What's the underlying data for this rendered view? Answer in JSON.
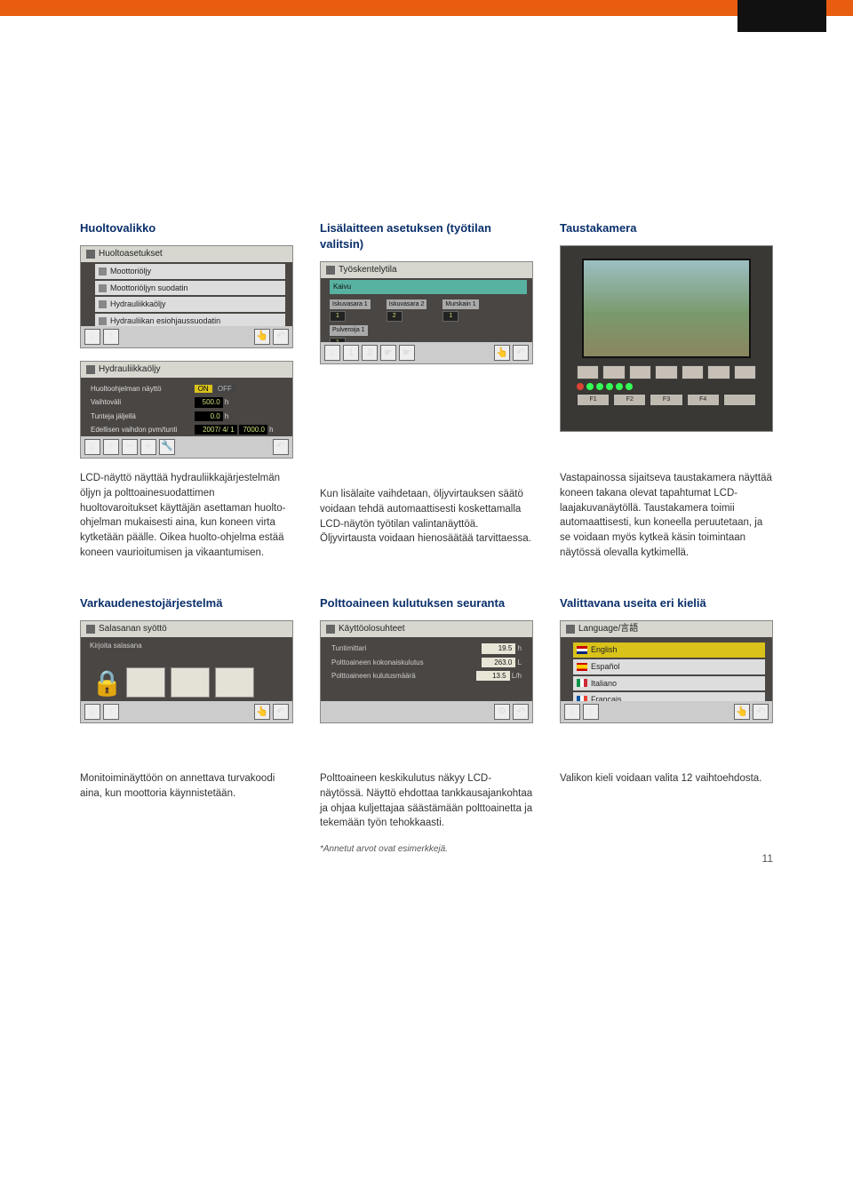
{
  "page_number": "11",
  "row1": {
    "col1": {
      "heading": "Huoltovalikko",
      "shot1": {
        "title": "Huoltoasetukset",
        "items": [
          "Moottoriöljy",
          "Moottoriöljyn suodatin",
          "Hydrauliikkaöljy",
          "Hydrauliikan esiohjaussuodatin"
        ]
      },
      "shot2": {
        "title": "Hydrauliikkaöljy",
        "huolto_label": "Huoltoohjelman näyttö",
        "on": "ON",
        "off": "OFF",
        "vaihtovali_label": "Vaihtoväli",
        "vaihtovali_val": "500.0",
        "vaihtovali_unit": "h",
        "tunteja_label": "Tunteja jäljellä",
        "tunteja_val": "0.0",
        "tunteja_unit": "h",
        "edell_label": "Edellisen vaihdon pvm/tunti",
        "edell_date": "2007/ 4/ 1",
        "edell_val": "7000.0",
        "edell_unit": "h"
      },
      "body": "LCD-näyttö näyttää hydrauliikkajärjestelmän öljyn ja polttoainesuodattimen huoltovaroitukset käyttäjän asettaman huolto-ohjelman mukaisesti aina, kun koneen virta kytketään päälle. Oikea huolto-ohjelma estää koneen vaurioitumisen ja vikaantumisen."
    },
    "col2": {
      "heading": "Lisälaitteen asetuksen (työtilan valitsin)",
      "shot1": {
        "title": "Työskentelytila",
        "sel": "Kaivu",
        "labels": {
          "a": "Iskuvasara 1",
          "b": "Iskuvasara 2",
          "c": "Murskain 1",
          "d": "Pulveroija 1"
        }
      },
      "body": "Kun lisälaite vaihdetaan, öljyvirtauksen säätö voidaan tehdä automaattisesti koskettamalla LCD-näytön työtilan valintanäyttöä. Öljyvirtausta voidaan hienosäätää tarvittaessa."
    },
    "col3": {
      "heading": "Taustakamera",
      "fn_labels": [
        "F1",
        "F2",
        "F3",
        "F4"
      ],
      "body": "Vastapainossa sijaitseva taustakamera näyttää koneen takana olevat tapahtumat LCD-laajakuvanäytöllä. Taustakamera toimii automaattisesti, kun koneella peruutetaan, ja se voidaan myös kytkeä käsin toimintaan näytössä olevalla kytkimellä."
    }
  },
  "row2": {
    "col1": {
      "heading": "Varkaudenestojärjestelmä",
      "shot": {
        "title": "Salasanan syöttö",
        "prompt": "Kirjoita salasana"
      },
      "body": "Monitoiminäyttöön on annettava turvakoodi aina, kun moottoria käynnistetään."
    },
    "col2": {
      "heading": "Polttoaineen kulutuksen seuranta",
      "shot": {
        "title": "Käyttöolosuhteet",
        "rows": [
          {
            "label": "Tuntimittari",
            "val": "19.5",
            "unit": "h"
          },
          {
            "label": "Polttoaineen kokonaiskulutus",
            "val": "263.0",
            "unit": "L"
          },
          {
            "label": "Polttoaineen kulutusmäärä",
            "val": "13.5",
            "unit": "L/h"
          }
        ]
      },
      "body": "Polttoaineen keskikulutus näkyy LCD-näytössä. Näyttö ehdottaa tankkausajankohtaa ja ohjaa kuljettajaa säästämään polttoainetta ja tekemään työn tehokkaasti.",
      "footnote": "*Annetut arvot ovat esimerkkejä."
    },
    "col3": {
      "heading": "Valittavana useita eri kieliä",
      "shot": {
        "title": "Language/言語",
        "langs": [
          "English",
          "Español",
          "Italiano",
          "Français"
        ]
      },
      "body": "Valikon kieli voidaan valita 12 vaihtoehdosta."
    }
  },
  "icons": {
    "down": "↓",
    "up": "↑",
    "hand": "☛",
    "return": "↶",
    "plusbox": "+",
    "minusbox": "−",
    "wrench": "🔧",
    "gear": "⚙",
    "touch": "👆"
  }
}
